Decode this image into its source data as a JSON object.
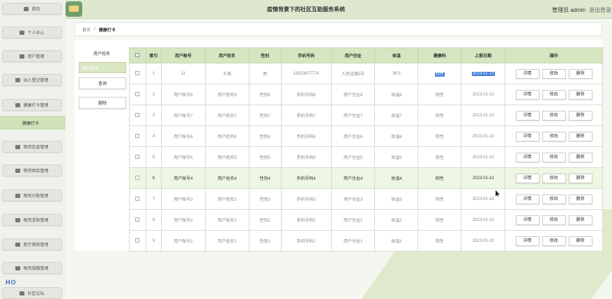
{
  "header": {
    "title": "疫情背景下的社区互助服务系统",
    "admin": "管理员 admin",
    "logout": "退出登录"
  },
  "sidebar": {
    "items": [
      {
        "label": "首页",
        "icon": "home-icon"
      },
      {
        "label": "个人中心",
        "icon": "user-icon"
      },
      {
        "label": "用户管理",
        "icon": "users-icon"
      },
      {
        "label": "出入登记管理",
        "icon": "list-icon"
      },
      {
        "label": "健康打卡管理",
        "icon": "clipboard-icon"
      },
      {
        "label": "物资信息管理",
        "icon": "send-icon"
      },
      {
        "label": "物资供给管理",
        "icon": "person-icon"
      },
      {
        "label": "物资分配管理",
        "icon": "grid-icon"
      },
      {
        "label": "物资求助管理",
        "icon": "chart-icon"
      },
      {
        "label": "医疗救助管理",
        "icon": "chat-icon"
      },
      {
        "label": "物资捐赠管理",
        "icon": "grid-icon"
      },
      {
        "label": "社区论坛",
        "icon": "grid-icon"
      }
    ],
    "sub_item": "健康打卡",
    "deco_text": "HO"
  },
  "breadcrumb": {
    "home": "首页",
    "sep": "/",
    "current": "健康打卡"
  },
  "search": {
    "label": "用户姓名",
    "placeholder": "用户姓名",
    "query_btn": "查询",
    "delete_btn": "删除"
  },
  "table": {
    "headers": [
      "",
      "索引",
      "用户账号",
      "用户姓名",
      "性别",
      "手机号码",
      "用户住址",
      "体温",
      "健康码",
      "上报日期",
      "操作"
    ],
    "rows": [
      {
        "index": "1",
        "account": "11",
        "name": "王强",
        "gender": "男",
        "phone": "13823877774",
        "address": "人民北路5号",
        "temp": "36.5",
        "code": "阴性",
        "date": "2023-01-13"
      },
      {
        "index": "2",
        "account": "用户账号8",
        "name": "用户姓名8",
        "gender": "性别8",
        "phone": "手机号码8",
        "address": "用户住址8",
        "temp": "体温8",
        "code": "阴性",
        "date": "2023-01-13"
      },
      {
        "index": "3",
        "account": "用户账号7",
        "name": "用户姓名7",
        "gender": "性别7",
        "phone": "手机号码7",
        "address": "用户住址7",
        "temp": "体温7",
        "code": "阴性",
        "date": "2023-01-13"
      },
      {
        "index": "4",
        "account": "用户账号6",
        "name": "用户姓名6",
        "gender": "性别6",
        "phone": "手机号码6",
        "address": "用户住址6",
        "temp": "体温6",
        "code": "阴性",
        "date": "2023-01-13"
      },
      {
        "index": "5",
        "account": "用户账号5",
        "name": "用户姓名5",
        "gender": "性别5",
        "phone": "手机号码5",
        "address": "用户住址5",
        "temp": "体温5",
        "code": "阴性",
        "date": "2023-01-13"
      },
      {
        "index": "6",
        "account": "用户账号4",
        "name": "用户姓名4",
        "gender": "性别4",
        "phone": "手机号码4",
        "address": "用户住址4",
        "temp": "体温4",
        "code": "阴性",
        "date": "2023-01-13"
      },
      {
        "index": "7",
        "account": "用户账号3",
        "name": "用户姓名3",
        "gender": "性别3",
        "phone": "手机号码3",
        "address": "用户住址3",
        "temp": "体温3",
        "code": "阴性",
        "date": "2023-01-13"
      },
      {
        "index": "8",
        "account": "用户账号2",
        "name": "用户姓名2",
        "gender": "性别2",
        "phone": "手机号码2",
        "address": "用户住址2",
        "temp": "体温2",
        "code": "阴性",
        "date": "2023-01-13"
      },
      {
        "index": "9",
        "account": "用户账号1",
        "name": "用户姓名1",
        "gender": "性别1",
        "phone": "手机号码1",
        "address": "用户住址1",
        "temp": "体温1",
        "code": "阴性",
        "date": "2023-01-13"
      }
    ],
    "actions": {
      "detail": "详情",
      "edit": "修改",
      "delete": "删除"
    },
    "highlighted_row": 6
  },
  "colors": {
    "accent": "#d6e6c0",
    "header_bg": "#dfe8cf",
    "selection": "#3a78d8"
  }
}
